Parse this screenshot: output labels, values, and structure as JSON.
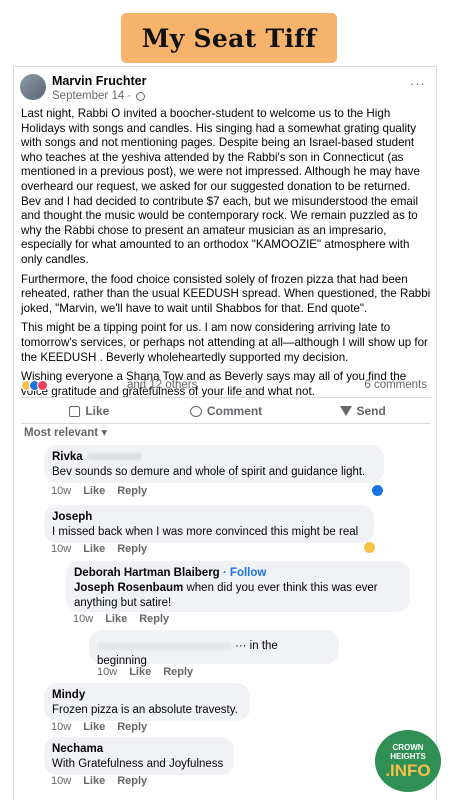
{
  "banner": {
    "title": "My Seat Tiff"
  },
  "post": {
    "author": "Marvin Fruchter",
    "date": "September 14 ·",
    "paragraphs": [
      "Last night, Rabbi O invited a boocher-student to welcome us to the High Holidays with songs and candles. His singing had a somewhat grating quality with songs and not mentioning pages.  Despite being an Israel-based student who teaches at the yeshiva attended by the Rabbi's son in Connecticut (as mentioned in a previous post), we were not impressed. Although he may have overheard our request, we asked for our suggested donation to be returned. Bev and I had decided to contribute $7 each, but we misunderstood the email and thought the music would be contemporary rock. We remain puzzled as to why the Rabbi chose to present an amateur musician as an impresario, especially for what amounted to an orthodox \"KAMOOZIE\" atmosphere with only candles.",
      "Furthermore, the food choice consisted solely of frozen pizza that had been reheated, rather than the usual KEEDUSH spread. When questioned, the Rabbi joked, \"Marvin, we'll have to wait until Shabbos for that. End quote\".",
      "This might be a tipping point for us. I am now considering arriving late to tomorrow's services, or perhaps not attending at all—although I will show up for the KEEDUSH . Beverly wholeheartedly supported my decision.",
      "Wishing everyone a Shana Tow and as Beverly says may all of you find the voice gratitude and gratefulness of your life and what not."
    ],
    "reactions_text": "and 12 others",
    "comments_count": "6 comments"
  },
  "actions": {
    "like": "Like",
    "comment": "Comment",
    "send": "Send"
  },
  "sort_label": "Most relevant ▾",
  "comments": [
    {
      "name": "Rivka",
      "text": "Bev sounds so demure and whole of spirit and guidance light.",
      "time": "10w",
      "like": "Like",
      "reply": "Reply"
    },
    {
      "name": "Joseph",
      "text": "I missed back when I was more convinced this might be real",
      "time": "10w",
      "like": "Like",
      "reply": "Reply"
    },
    {
      "name": "Deborah Hartman Blaiberg",
      "follow": "· Follow",
      "mention": "Joseph Rosenbaum",
      "text": " when did you ever think this was ever anything but satire!",
      "time": "10w",
      "like": "Like",
      "reply": "Reply"
    },
    {
      "text": "··· in the beginning",
      "time": "10w",
      "like": "Like",
      "reply": "Reply"
    },
    {
      "name": "Mindy",
      "text": "Frozen pizza is an absolute travesty.",
      "time": "10w",
      "like": "Like",
      "reply": "Reply"
    },
    {
      "name": "Nechama",
      "text": "With Gratefulness and Joyfulness",
      "time": "10w",
      "like": "Like",
      "reply": "Reply"
    }
  ],
  "watermark": {
    "line1": "CROWN",
    "line2": "HEIGHTS",
    "line3": ".INFO"
  }
}
